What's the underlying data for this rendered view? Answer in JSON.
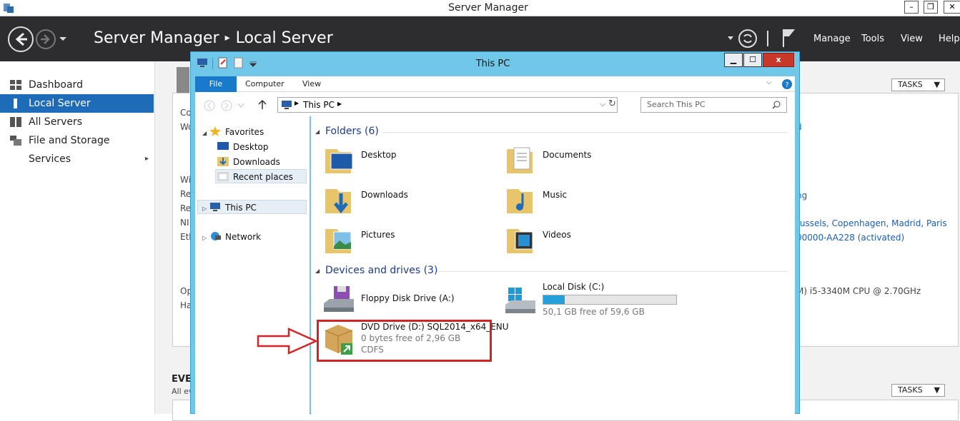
{
  "server_manager": {
    "window_title": "Server Manager",
    "breadcrumb_root": "Server Manager",
    "breadcrumb_sep": "▸",
    "breadcrumb_current": "Local Server",
    "menu": [
      "Manage",
      "Tools",
      "View",
      "Help"
    ],
    "sidebar": [
      {
        "label": "Dashboard",
        "icon": "dashboard-icon"
      },
      {
        "label": "Local Server",
        "icon": "local-server-icon",
        "active": true
      },
      {
        "label": "All Servers",
        "icon": "all-servers-icon"
      },
      {
        "label": "File and Storage Services",
        "icon": "storage-icon",
        "chevron": "▸"
      }
    ],
    "tasks_label": "TASKS",
    "bg_fragments": {
      "co": "Co",
      "wo": "Wo",
      "wi": "Wi",
      "re1": "Re",
      "re2": "Re",
      "ni": "NI",
      "eth": "Eth",
      "op": "Op",
      "ha": "Ha",
      "link_d": "d",
      "link_ng": "ng",
      "link_tz": "russels, Copenhagen, Madrid, Paris",
      "link_pid": "00000-AA228 (activated)",
      "cpu": "M) i5-3340M CPU @ 2.70GHz"
    },
    "events_title": "EVE",
    "events_sub": "All ev"
  },
  "explorer": {
    "title": "This PC",
    "tabs": [
      "File",
      "Computer",
      "View"
    ],
    "address": "This PC",
    "search_placeholder": "Search This PC",
    "nav": {
      "favorites": "Favorites",
      "desktop": "Desktop",
      "downloads": "Downloads",
      "recent": "Recent places",
      "this_pc": "This PC",
      "network": "Network"
    },
    "folders_header": "Folders (6)",
    "folders": [
      "Desktop",
      "Documents",
      "Downloads",
      "Music",
      "Pictures",
      "Videos"
    ],
    "devices_header": "Devices and drives (3)",
    "devices": {
      "floppy": {
        "name": "Floppy Disk Drive (A:)"
      },
      "local": {
        "name": "Local Disk (C:)",
        "free": "50,1 GB free of 59,6 GB",
        "used_fraction": 0.16
      },
      "dvd": {
        "name": "DVD Drive (D:) SQL2014_x64_ENU",
        "free": "0 bytes free of 2,96 GB",
        "fs": "CDFS"
      }
    }
  },
  "colors": {
    "accent_blue": "#1e6bb8",
    "explorer_frame": "#70c7e8",
    "highlight_red": "#d12525"
  }
}
